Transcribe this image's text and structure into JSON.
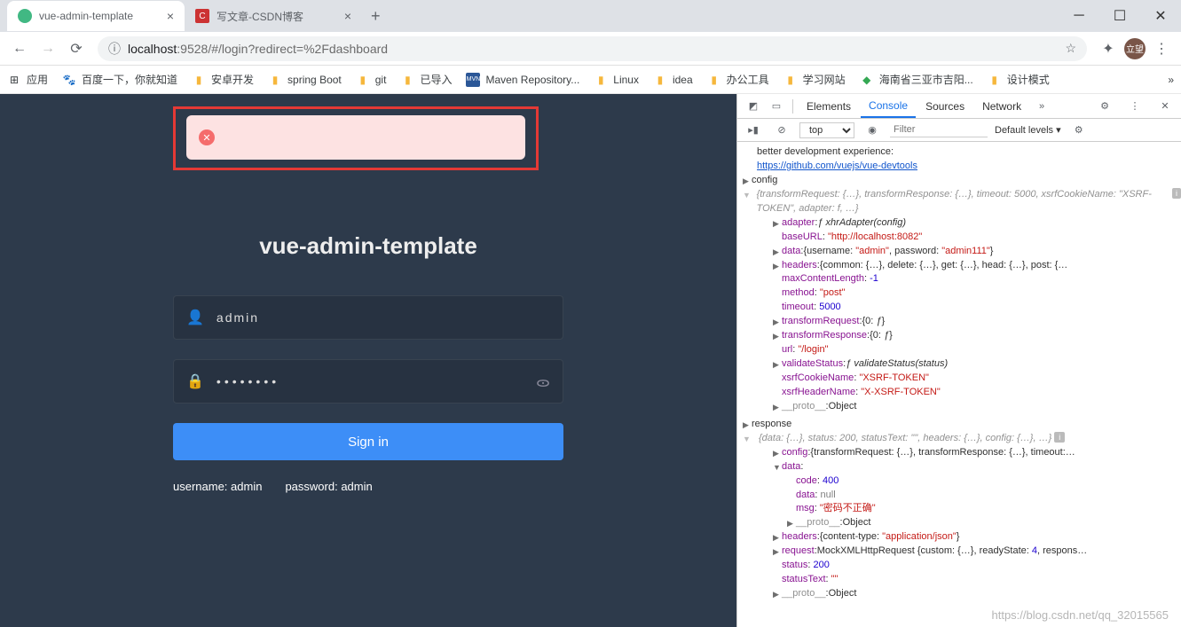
{
  "browser": {
    "tabs": [
      {
        "title": "vue-admin-template",
        "favicon_color": "#41b883",
        "active": true
      },
      {
        "title": "写文章-CSDN博客",
        "favicon_color": "#cc3333",
        "active": false
      }
    ],
    "address": {
      "host": "localhost",
      "port": "9528",
      "path": "/#/login?redirect=%2Fdashboard"
    },
    "avatar_text": "立望",
    "bookmarks": [
      {
        "label": "应用",
        "icon": "apps"
      },
      {
        "label": "百度一下，你就知道",
        "icon": "baidu"
      },
      {
        "label": "安卓开发",
        "icon": "folder"
      },
      {
        "label": "spring Boot",
        "icon": "folder"
      },
      {
        "label": "git",
        "icon": "folder"
      },
      {
        "label": "已导入",
        "icon": "folder"
      },
      {
        "label": "Maven Repository...",
        "icon": "mvn"
      },
      {
        "label": "Linux",
        "icon": "folder"
      },
      {
        "label": "idea",
        "icon": "folder"
      },
      {
        "label": "办公工具",
        "icon": "folder"
      },
      {
        "label": "学习网站",
        "icon": "folder"
      },
      {
        "label": "海南省三亚市吉阳...",
        "icon": "map"
      },
      {
        "label": "设计模式",
        "icon": "folder"
      }
    ]
  },
  "login": {
    "title": "vue-admin-template",
    "username_value": "admin",
    "password_masked": "••••••••",
    "signin_label": "Sign in",
    "hint_username": "username: admin",
    "hint_password": "password: admin"
  },
  "devtools": {
    "tabs": [
      "Elements",
      "Console",
      "Sources",
      "Network"
    ],
    "active_tab": "Console",
    "context": "top",
    "filter_placeholder": "Filter",
    "levels": "Default levels ▾",
    "log": {
      "line1": "better development experience:",
      "link": "https://github.com/vuejs/vue-devtools",
      "config_label": "config",
      "config_preview": "{transformRequest: {…}, transformResponse: {…}, timeout: 5000, xsrfCookieName: \"XSRF-TOKEN\", adapter: f, …}",
      "adapter": "ƒ xhrAdapter(config)",
      "baseURL": "\"http://localhost:8082\"",
      "data_inline": "{username: \"admin\", password: \"admin111\"}",
      "headers_inline": "{common: {…}, delete: {…}, get: {…}, head: {…}, post: {…",
      "maxContentLength": "-1",
      "method": "\"post\"",
      "timeout": "5000",
      "transformRequest": "{0: ƒ}",
      "transformResponse": "{0: ƒ}",
      "url": "\"/login\"",
      "validateStatus": "ƒ validateStatus(status)",
      "xsrfCookieName": "\"XSRF-TOKEN\"",
      "xsrfHeaderName": "\"X-XSRF-TOKEN\"",
      "proto_obj": "Object",
      "response_label": "response",
      "response_preview": "{data: {…}, status: 200, statusText: \"\", headers: {…}, config: {…}, …}",
      "resp_config": "{transformRequest: {…}, transformResponse: {…}, timeout:…",
      "resp_data_code": "400",
      "resp_data_data": "null",
      "resp_data_msg": "\"密码不正确\"",
      "resp_headers": "{content-type: \"application/json\"}",
      "resp_request": "MockXMLHttpRequest {custom: {…}, readyState: 4, respons…",
      "resp_status": "200",
      "resp_statusText": "\"\""
    }
  },
  "watermark": "https://blog.csdn.net/qq_32015565"
}
